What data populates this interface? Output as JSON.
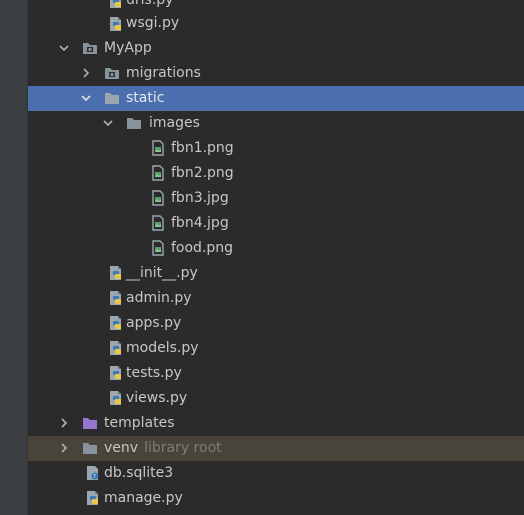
{
  "tree": {
    "top_partial": [
      {
        "label": "urls.py"
      },
      {
        "label": "wsgi.py"
      }
    ],
    "app": {
      "label": "MyApp",
      "expanded": true
    },
    "migrations": {
      "label": "migrations",
      "expanded": false
    },
    "static": {
      "label": "static",
      "expanded": true,
      "selected": true
    },
    "images": {
      "label": "images",
      "expanded": true
    },
    "image_files": [
      {
        "label": "fbn1.png"
      },
      {
        "label": "fbn2.png"
      },
      {
        "label": "fbn3.jpg"
      },
      {
        "label": "fbn4.jpg"
      },
      {
        "label": "food.png"
      }
    ],
    "py_files": [
      {
        "label": "__init__.py"
      },
      {
        "label": "admin.py"
      },
      {
        "label": "apps.py"
      },
      {
        "label": "models.py"
      },
      {
        "label": "tests.py"
      },
      {
        "label": "views.py"
      }
    ],
    "templates": {
      "label": "templates",
      "expanded": false
    },
    "venv": {
      "label": "venv",
      "note": "library root",
      "expanded": false
    },
    "root_files": [
      {
        "label": "db.sqlite3"
      },
      {
        "label": "manage.py"
      }
    ]
  },
  "colors": {
    "background": "#2b2b2b",
    "selection": "#4b6eaf",
    "library_root_highlight": "#48443a",
    "folder": "#87939a",
    "templates_folder": "#9575cd",
    "python_blue": "#3d7ab5",
    "python_yellow": "#e9c84a"
  },
  "icons": {
    "python_file": "python-file-icon",
    "image_file": "image-file-icon",
    "folder": "folder-icon",
    "module_folder": "module-folder-icon",
    "database_file": "database-file-icon"
  }
}
